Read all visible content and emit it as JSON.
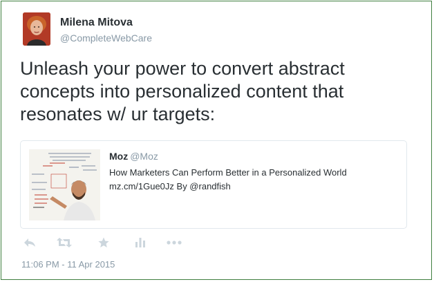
{
  "tweet": {
    "author": {
      "name": "Milena Mitova",
      "handle": "@CompleteWebCare"
    },
    "text": "Unleash your power to convert abstract concepts into personalized content that resonates w/ ur targets:",
    "card": {
      "author_name": "Moz",
      "author_handle": "@Moz",
      "title": "How Marketers Can Perform Better in a Personalized World",
      "link_line": "mz.cm/1Gue0Jz By @randfish",
      "thumbnail": "whiteboard-presenter-image"
    },
    "actions": [
      {
        "name": "reply",
        "icon": "reply-icon"
      },
      {
        "name": "retweet",
        "icon": "retweet-icon"
      },
      {
        "name": "favorite",
        "icon": "star-icon"
      },
      {
        "name": "analytics",
        "icon": "bar-chart-icon"
      },
      {
        "name": "more",
        "icon": "more-dots-icon"
      }
    ],
    "timestamp": "11:06 PM - 11 Apr 2015"
  },
  "colors": {
    "text": "#292f33",
    "muted": "#8899a6",
    "icon": "#ccd6dd",
    "border": "#e1e8ed",
    "frame": "#3f7f3f"
  }
}
